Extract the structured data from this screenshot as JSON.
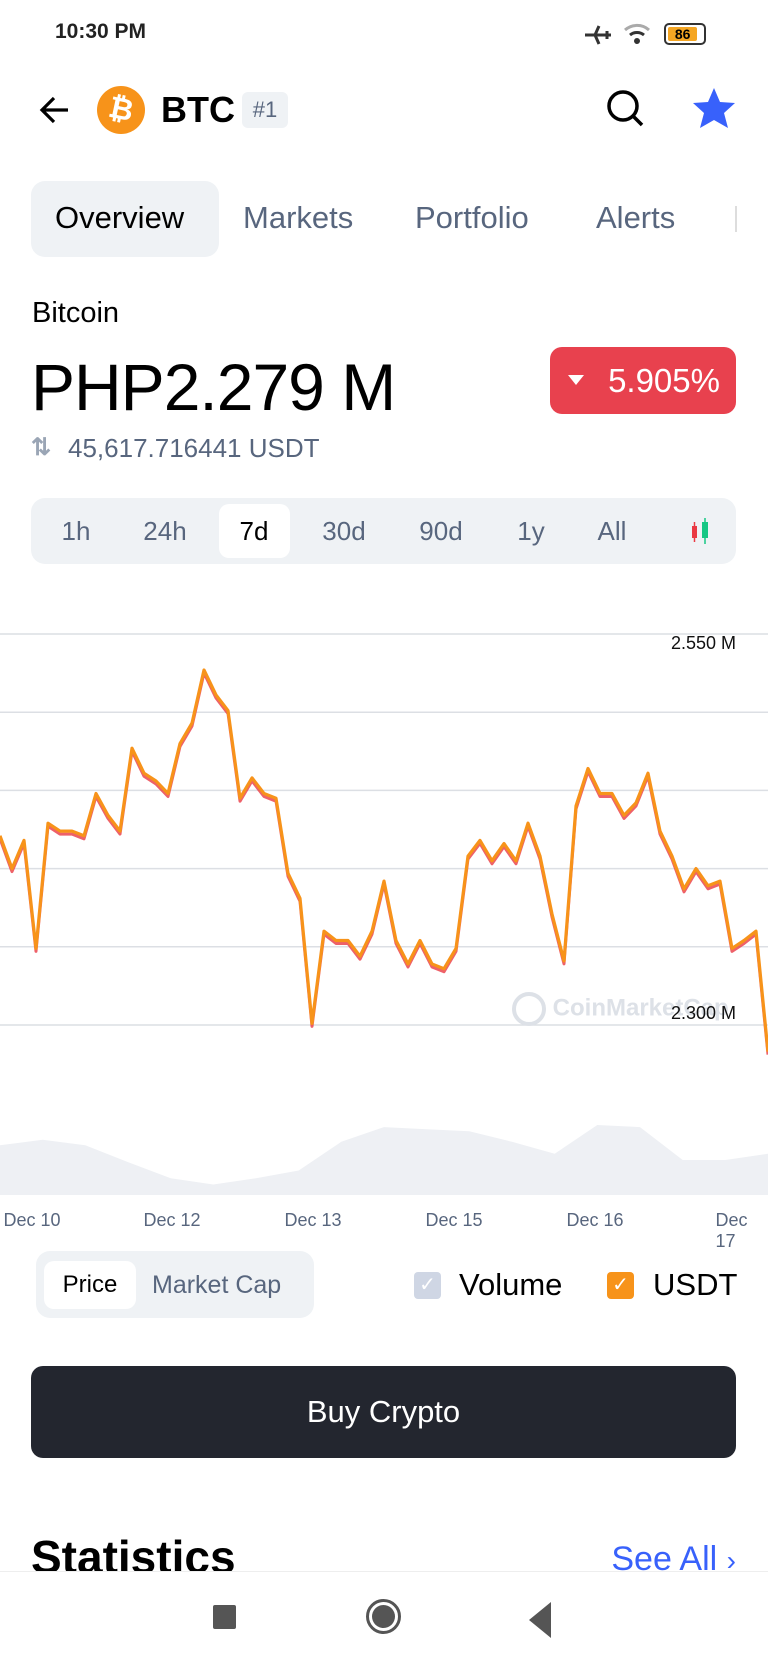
{
  "status_bar": {
    "time": "10:30 PM",
    "battery": "86",
    "icons": [
      "airplane-icon",
      "wifi-icon",
      "battery-icon"
    ]
  },
  "header": {
    "symbol": "BTC",
    "rank": "#1",
    "icons": [
      "back-arrow-icon",
      "bitcoin-logo-icon",
      "search-icon",
      "star-icon"
    ]
  },
  "tabs": [
    {
      "label": "Overview",
      "active": true
    },
    {
      "label": "Markets"
    },
    {
      "label": "Portfolio"
    },
    {
      "label": "Alerts"
    }
  ],
  "coin": {
    "name": "Bitcoin",
    "price": "PHP2.279 M",
    "change": "5.905%",
    "change_direction": "down",
    "usdt_price": "45,617.716441 USDT"
  },
  "timeframes": {
    "items": [
      "1h",
      "24h",
      "7d",
      "30d",
      "90d",
      "1y",
      "All"
    ],
    "selected": "7d",
    "candle_icon": "candlestick-icon"
  },
  "colors": {
    "price_line": "#f7931a",
    "php_line": "#ea3943",
    "negative": "#e8414e",
    "accent": "#3861fb",
    "button": "#23262f"
  },
  "chart_data": {
    "type": "line",
    "y_tick_labels": [
      "2.550 M",
      "2.300 M"
    ],
    "ylim": [
      2.3,
      2.55
    ],
    "y_unit": "M",
    "grid": true,
    "gridlines": [
      2.55,
      2.5,
      2.45,
      2.4,
      2.35,
      2.3
    ],
    "x_tick_labels": [
      "Dec 10",
      "Dec 12",
      "Dec 13",
      "Dec 15",
      "Dec 16",
      "Dec 17"
    ],
    "watermark": "CoinMarketCap",
    "series": [
      {
        "values": [
          2.421,
          2.4,
          2.418,
          2.349,
          2.429,
          2.424,
          2.424,
          2.421,
          2.448,
          2.434,
          2.424,
          2.477,
          2.461,
          2.456,
          2.448,
          2.48,
          2.493,
          2.527,
          2.511,
          2.501,
          2.445,
          2.458,
          2.448,
          2.445,
          2.397,
          2.381,
          2.301,
          2.36,
          2.354,
          2.354,
          2.344,
          2.36,
          2.392,
          2.354,
          2.339,
          2.354,
          2.339,
          2.336,
          2.349,
          2.408,
          2.418,
          2.405,
          2.416,
          2.405,
          2.429,
          2.408,
          2.371,
          2.341,
          2.44,
          2.464,
          2.448,
          2.448,
          2.434,
          2.442,
          2.461,
          2.424,
          2.408,
          2.387,
          2.4,
          2.389,
          2.392,
          2.349,
          2.354,
          2.36,
          2.283
        ]
      }
    ],
    "volume_relative": [
      0.71,
      0.79,
      0.71,
      0.47,
      0.24,
      0.15,
      0.24,
      0.35,
      0.76,
      0.97,
      0.94,
      0.91,
      0.76,
      0.59,
      1.0,
      0.97,
      0.5,
      0.5,
      0.59
    ]
  },
  "chart_controls": {
    "segments": [
      "Price",
      "Market Cap"
    ],
    "selected": "Price",
    "checkboxes": [
      {
        "label": "Volume",
        "checked": true,
        "color": "#cfd6e4"
      },
      {
        "label": "USDT",
        "checked": true,
        "color": "#f7931a"
      }
    ]
  },
  "buy_button": "Buy Crypto",
  "statistics": {
    "title": "Statistics",
    "see_all": "See All"
  },
  "nav_bar": {
    "icons": [
      "recents-square-icon",
      "home-circle-icon",
      "back-triangle-icon"
    ]
  }
}
